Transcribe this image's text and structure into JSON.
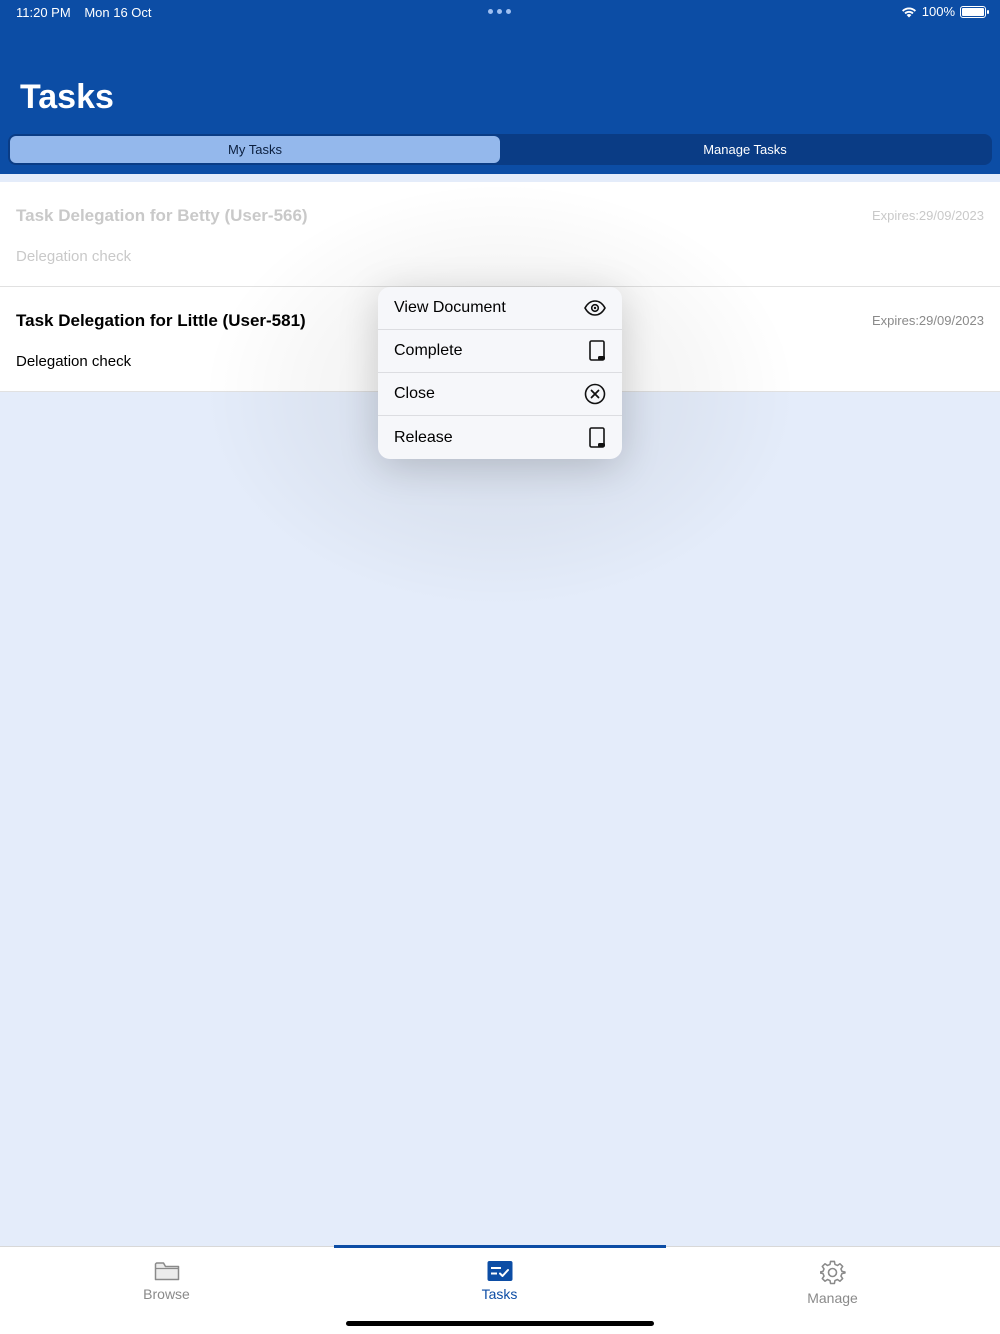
{
  "status_bar": {
    "time": "11:20 PM",
    "date": "Mon 16 Oct",
    "battery": "100%"
  },
  "header": {
    "title": "Tasks"
  },
  "segments": [
    {
      "label": "My Tasks",
      "active": true
    },
    {
      "label": "Manage Tasks",
      "active": false
    }
  ],
  "tasks": [
    {
      "title": "Task Delegation for Betty (User-566)",
      "subtitle": "Delegation check",
      "expires": "Expires:29/09/2023"
    },
    {
      "title": "Task Delegation for Little (User-581)",
      "subtitle": "Delegation check",
      "expires": "Expires:29/09/2023"
    }
  ],
  "context_menu": {
    "items": [
      {
        "label": "View Document",
        "icon": "eye-icon"
      },
      {
        "label": "Complete",
        "icon": "tablet-icon"
      },
      {
        "label": "Close",
        "icon": "close-circle-icon"
      },
      {
        "label": "Release",
        "icon": "tablet-icon"
      }
    ]
  },
  "tabbar": {
    "items": [
      {
        "label": "Browse",
        "icon": "folder-icon"
      },
      {
        "label": "Tasks",
        "icon": "tasks-icon",
        "active": true
      },
      {
        "label": "Manage",
        "icon": "gear-icon"
      }
    ]
  },
  "colors": {
    "primary": "#0c4da5",
    "segment_active": "#94b8ec",
    "background": "#e4ecfa"
  }
}
